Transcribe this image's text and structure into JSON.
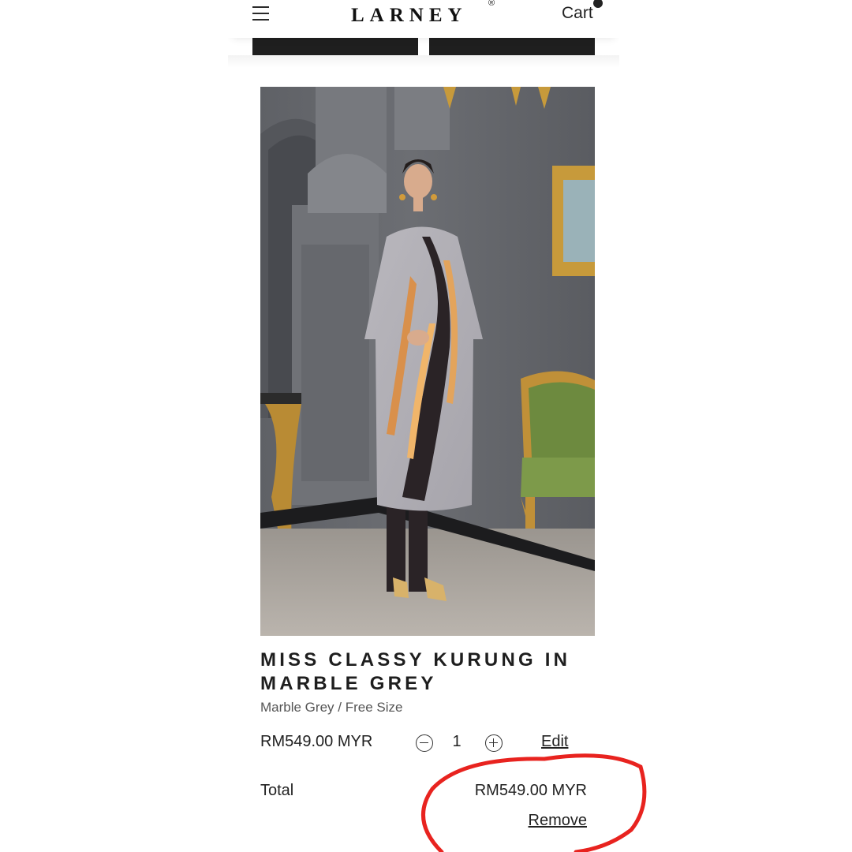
{
  "header": {
    "brand": "LARNEY",
    "brand_mark": "®",
    "cart_label": "Cart",
    "menu_icon": "hamburger-menu-icon"
  },
  "product": {
    "title": "MISS CLASSY KURUNG IN MARBLE GREY",
    "variant": "Marble Grey / Free Size",
    "unit_price": "RM549.00 MYR",
    "quantity": "1",
    "edit_label": "Edit"
  },
  "summary": {
    "total_label": "Total",
    "total_value": "RM549.00 MYR",
    "remove_label": "Remove"
  },
  "colors": {
    "annotation": "#e8231f",
    "dark_tab": "#1f1f1f"
  }
}
